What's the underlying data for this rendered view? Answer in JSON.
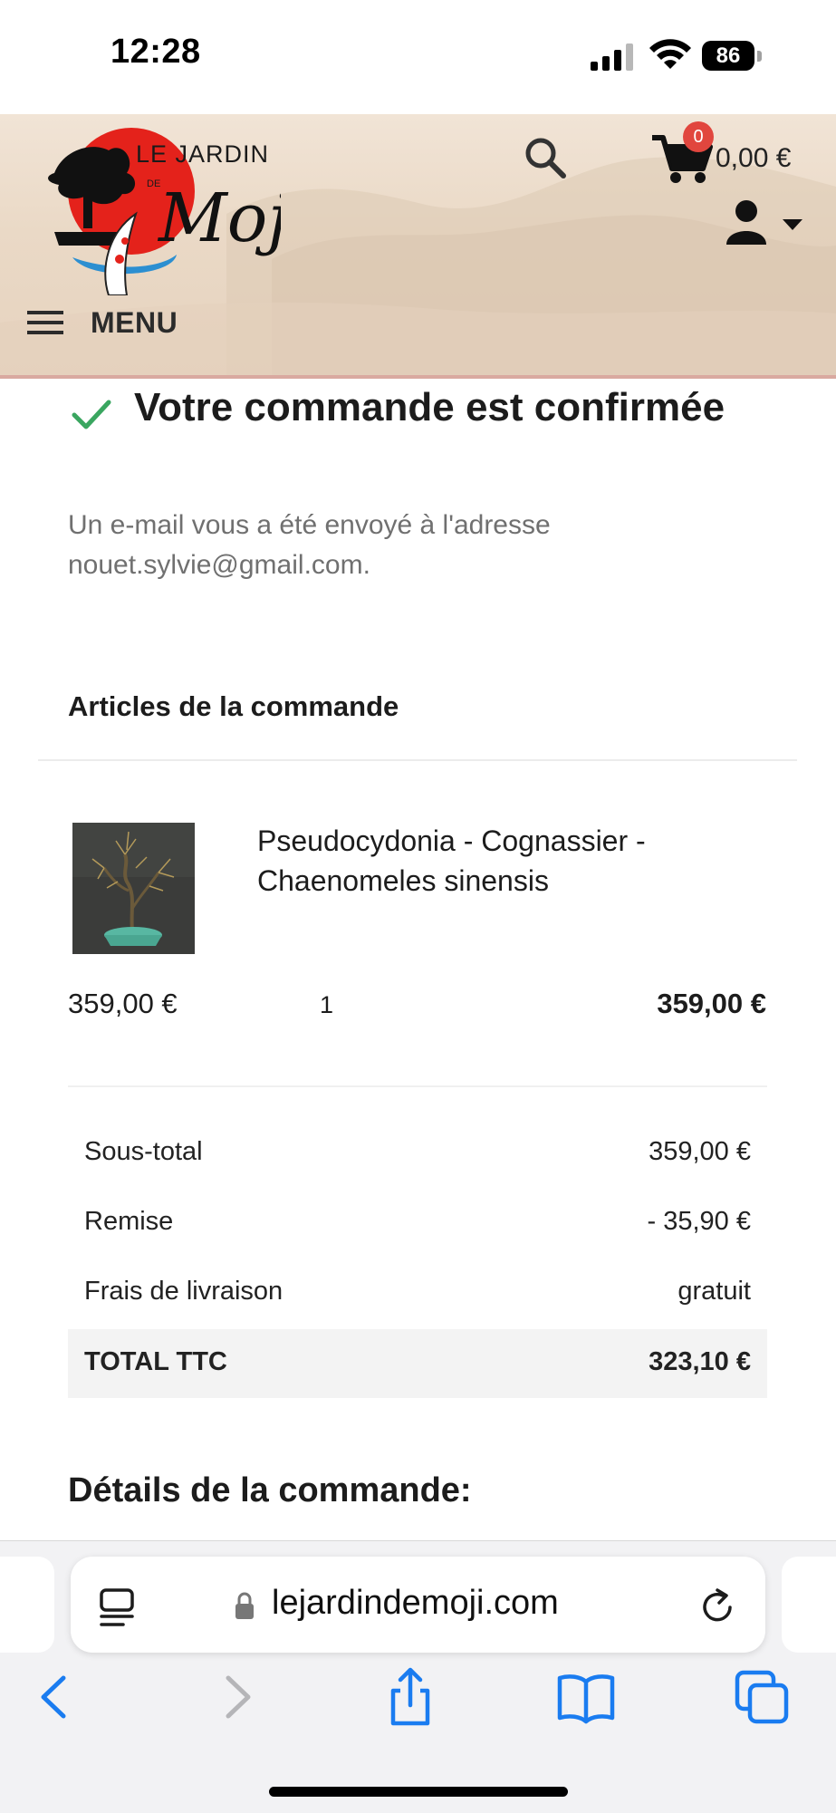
{
  "status_bar": {
    "time": "12:28",
    "battery": "86"
  },
  "header": {
    "logo_text_top": "LE JARDIN",
    "logo_text_de": "DE",
    "logo_text_main": "Moji",
    "cart_count": "0",
    "cart_total": "0,00 €",
    "menu_label": "MENU"
  },
  "confirmation": {
    "title": "Votre commande est confirmée",
    "message": "Un e-mail vous a été envoyé à l'adresse nouet.sylvie@gmail.com."
  },
  "order_items": {
    "section_title": "Articles de la commande",
    "items": [
      {
        "name": "Pseudocydonia - Cognassier - Chaenomeles sinensis",
        "unit_price": "359,00 €",
        "quantity": "1",
        "total": "359,00 €"
      }
    ]
  },
  "summary": {
    "subtotal_label": "Sous-total",
    "subtotal_value": "359,00 €",
    "discount_label": "Remise",
    "discount_value": "- 35,90 €",
    "shipping_label": "Frais de livraison",
    "shipping_value": "gratuit",
    "total_label": "TOTAL TTC",
    "total_value": "323,10 €"
  },
  "details_title": "Détails de la commande:",
  "browser": {
    "url": "lejardindemoji.com"
  },
  "colors": {
    "accent_red": "#e1463e",
    "check_green": "#3aa660",
    "safari_blue": "#1a7cf0"
  }
}
